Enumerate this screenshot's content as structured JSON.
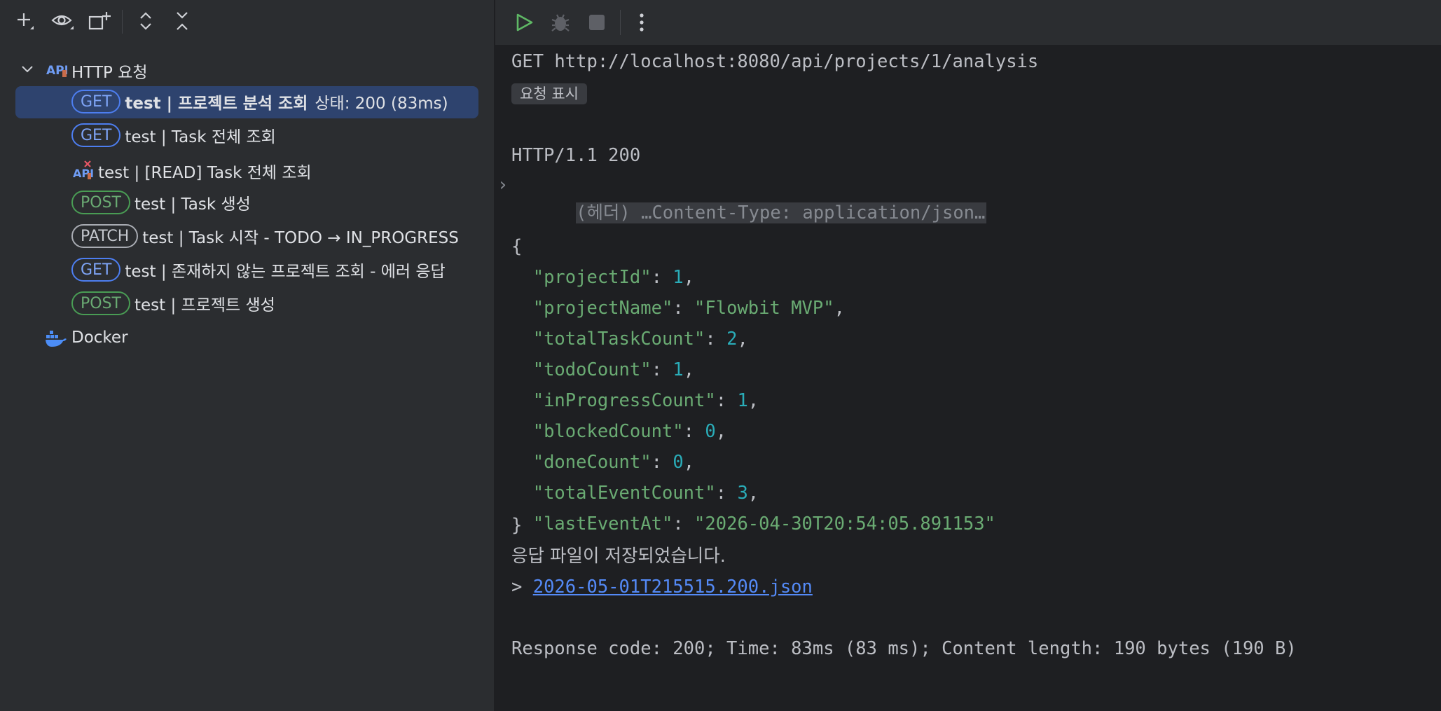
{
  "left_panel": {
    "root": {
      "label": "HTTP 요청"
    },
    "items": [
      {
        "method": "GET",
        "name": "test  |  프로젝트 분석 조회",
        "status": "상태: 200 (83ms)",
        "selected": true
      },
      {
        "method": "GET",
        "name": "test  |  Task 전체 조회"
      },
      {
        "method": "",
        "name": "test | [READ] Task 전체 조회"
      },
      {
        "method": "POST",
        "name": "test  |  Task 생성"
      },
      {
        "method": "PATCH",
        "name": "test  |  Task 시작 - TODO → IN_PROGRESS"
      },
      {
        "method": "GET",
        "name": "test  |  존재하지 않는 프로젝트 조회 - 에러 응답"
      },
      {
        "method": "POST",
        "name": "test  |  프로젝트 생성"
      }
    ],
    "docker": {
      "label": "Docker"
    }
  },
  "console": {
    "request_line": "GET http://localhost:8080/api/projects/1/analysis",
    "show_request_label": "요청 표시",
    "status_line": "HTTP/1.1 200",
    "headers_collapsed": "(헤더) …Content-Type: application/json…",
    "json": {
      "open": "{",
      "close": "}",
      "fields": [
        {
          "key": "\"projectId\"",
          "value": "1",
          "kind": "num",
          "comma": ","
        },
        {
          "key": "\"projectName\"",
          "value": "\"Flowbit MVP\"",
          "kind": "str",
          "comma": ","
        },
        {
          "key": "\"totalTaskCount\"",
          "value": "2",
          "kind": "num",
          "comma": ","
        },
        {
          "key": "\"todoCount\"",
          "value": "1",
          "kind": "num",
          "comma": ","
        },
        {
          "key": "\"inProgressCount\"",
          "value": "1",
          "kind": "num",
          "comma": ","
        },
        {
          "key": "\"blockedCount\"",
          "value": "0",
          "kind": "num",
          "comma": ","
        },
        {
          "key": "\"doneCount\"",
          "value": "0",
          "kind": "num",
          "comma": ","
        },
        {
          "key": "\"totalEventCount\"",
          "value": "3",
          "kind": "num",
          "comma": ","
        },
        {
          "key": "\"lastEventAt\"",
          "value": "\"2026-04-30T20:54:05.891153\"",
          "kind": "str",
          "comma": ""
        }
      ]
    },
    "saved_message": "응답 파일이 저장되었습니다.",
    "saved_prompt": "> ",
    "saved_file": "2026-05-01T215515.200.json",
    "summary": "Response code: 200; Time: 83ms (83 ms); Content length: 190 bytes (190 B)"
  },
  "colors": {
    "accent": "#548af7",
    "run_green": "#5fb865",
    "get_blue": "#4d7ef0",
    "post_green": "#499c54",
    "json_key": "#6aab73",
    "json_number": "#2aacb8"
  },
  "icons": [
    "add-icon",
    "eye-icon",
    "add-window-icon",
    "expand-all-icon",
    "collapse-all-icon",
    "chevron-down-icon",
    "api-icon",
    "api-error-icon",
    "docker-icon",
    "run-icon",
    "debug-icon",
    "stop-icon",
    "more-vertical-icon"
  ]
}
